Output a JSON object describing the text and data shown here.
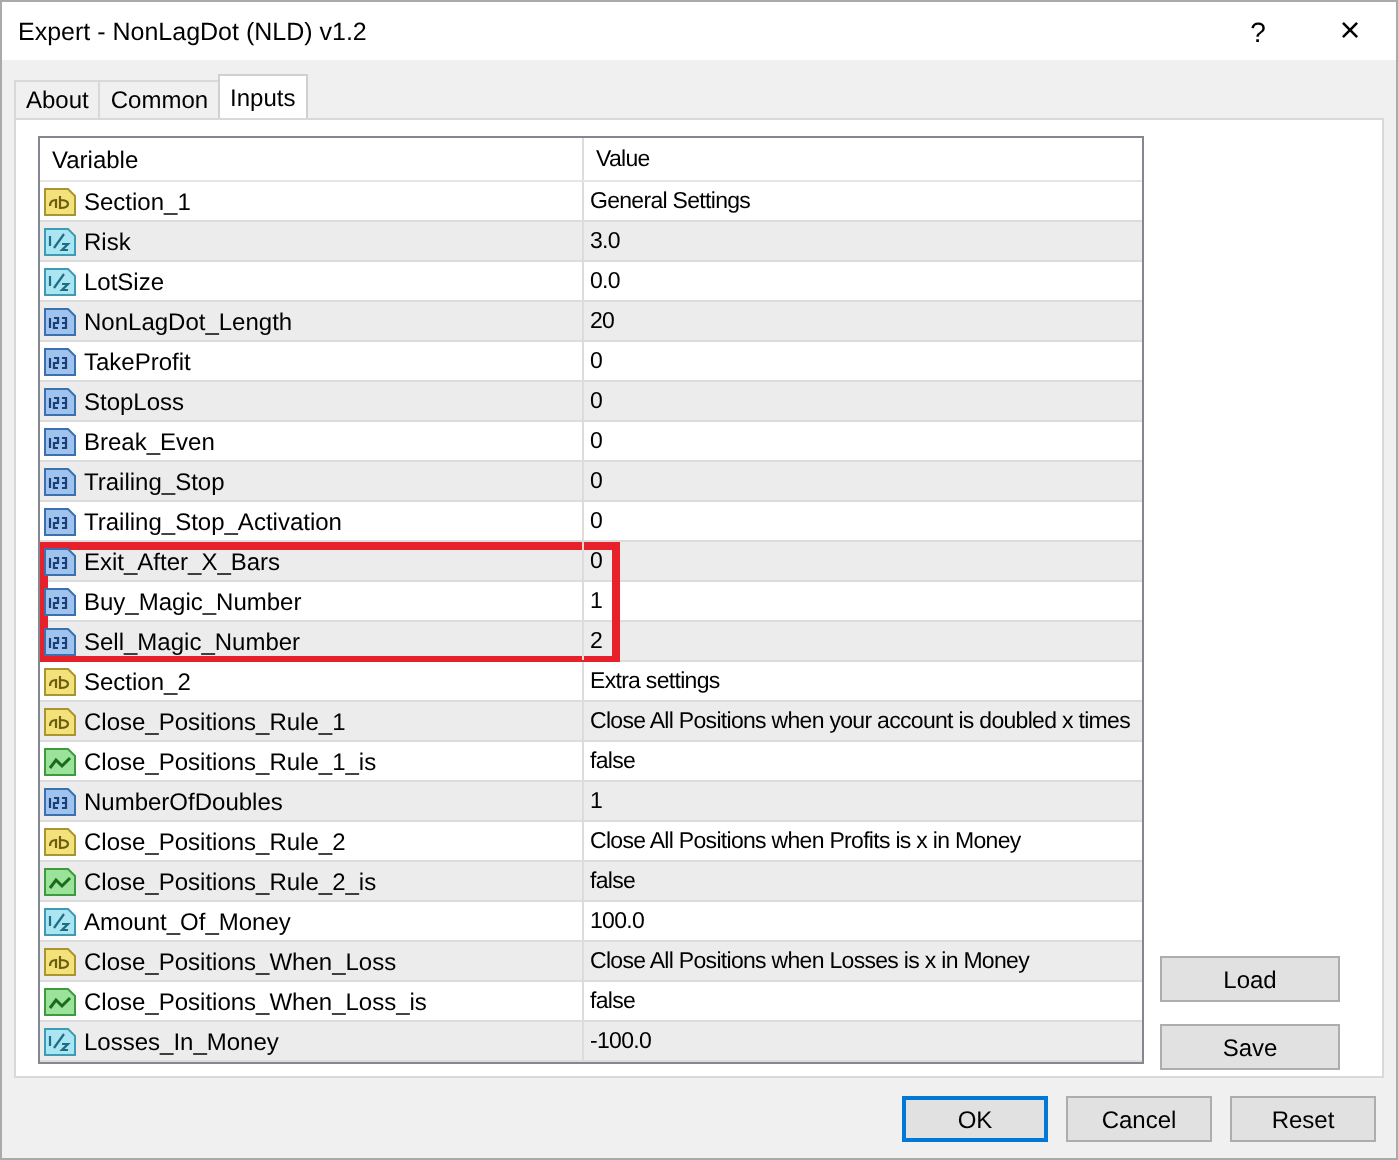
{
  "window": {
    "title": "Expert - NonLagDot (NLD) v1.2",
    "help": "?",
    "close": "×"
  },
  "tabs": [
    {
      "label": "About",
      "selected": false
    },
    {
      "label": "Common",
      "selected": false
    },
    {
      "label": "Inputs",
      "selected": true
    }
  ],
  "table": {
    "columns": [
      "Variable",
      "Value"
    ],
    "rows": [
      {
        "kind": "string",
        "name": "Section_1",
        "value": "General Settings",
        "highlighted": false
      },
      {
        "kind": "double",
        "name": "Risk",
        "value": "3.0",
        "highlighted": false
      },
      {
        "kind": "double",
        "name": "LotSize",
        "value": "0.0",
        "highlighted": false
      },
      {
        "kind": "int",
        "name": "NonLagDot_Length",
        "value": "20",
        "highlighted": false
      },
      {
        "kind": "int",
        "name": "TakeProfit",
        "value": "0",
        "highlighted": false
      },
      {
        "kind": "int",
        "name": "StopLoss",
        "value": "0",
        "highlighted": false
      },
      {
        "kind": "int",
        "name": "Break_Even",
        "value": "0",
        "highlighted": false
      },
      {
        "kind": "int",
        "name": "Trailing_Stop",
        "value": "0",
        "highlighted": false
      },
      {
        "kind": "int",
        "name": "Trailing_Stop_Activation",
        "value": "0",
        "highlighted": false
      },
      {
        "kind": "int",
        "name": "Exit_After_X_Bars",
        "value": "0",
        "highlighted": true
      },
      {
        "kind": "int",
        "name": "Buy_Magic_Number",
        "value": "1",
        "highlighted": true
      },
      {
        "kind": "int",
        "name": "Sell_Magic_Number",
        "value": "2",
        "highlighted": true
      },
      {
        "kind": "string",
        "name": "Section_2",
        "value": "Extra settings",
        "highlighted": false
      },
      {
        "kind": "string",
        "name": "Close_Positions_Rule_1",
        "value": "Close All Positions when your account is doubled x times",
        "highlighted": false
      },
      {
        "kind": "bool",
        "name": "Close_Positions_Rule_1_is",
        "value": "false",
        "highlighted": false
      },
      {
        "kind": "int",
        "name": "NumberOfDoubles",
        "value": "1",
        "highlighted": false
      },
      {
        "kind": "string",
        "name": "Close_Positions_Rule_2",
        "value": "Close All Positions when Profits is x in Money",
        "highlighted": false
      },
      {
        "kind": "bool",
        "name": "Close_Positions_Rule_2_is",
        "value": "false",
        "highlighted": false
      },
      {
        "kind": "double",
        "name": "Amount_Of_Money",
        "value": "100.0",
        "highlighted": false
      },
      {
        "kind": "string",
        "name": "Close_Positions_When_Loss",
        "value": "Close All Positions when Losses is x in Money",
        "highlighted": false
      },
      {
        "kind": "bool",
        "name": "Close_Positions_When_Loss_is",
        "value": "false",
        "highlighted": false
      },
      {
        "kind": "double",
        "name": "Losses_In_Money",
        "value": "-100.0",
        "highlighted": false
      }
    ]
  },
  "side_buttons": [
    "Load",
    "Save"
  ],
  "buttons": [
    {
      "label": "OK",
      "default": true
    },
    {
      "label": "Cancel",
      "default": false
    },
    {
      "label": "Reset",
      "default": false
    }
  ]
}
